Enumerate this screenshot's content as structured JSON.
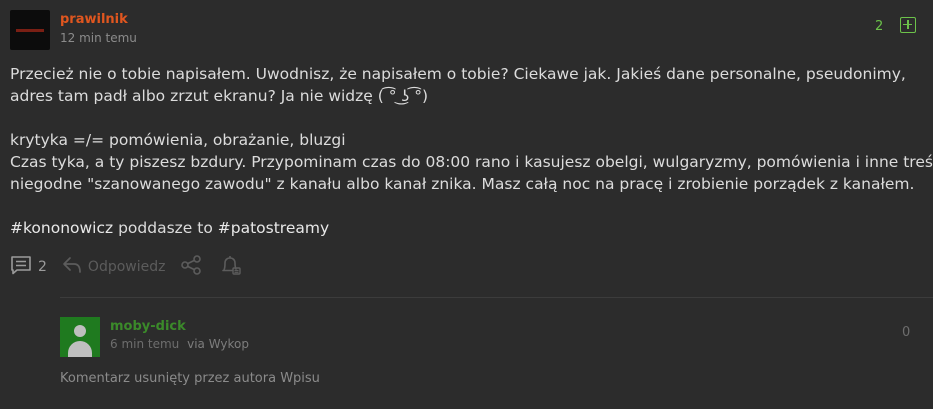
{
  "entry": {
    "author": "prawilnik",
    "time": "12 min temu",
    "votes": "2",
    "body": {
      "line1": "Przecież nie o tobie napisałem. Uwodnisz, że napisałem o tobie? Ciekawe jak. Jakieś dane personalne, pseudonimy,",
      "line2": "adres tam padł albo zrzut ekranu? Ja nie widzę ( ͡° ͜ʖ ͡°)",
      "line3": "krytyka =/= pomówienia, obrażanie, bluzgi",
      "line4": "Czas tyka, a ty piszesz bzdury. Przypominam czas do 08:00 rano i kasujesz obelgi, wulgaryzmy, pomówienia i inne treści",
      "line5": "niegodne \"szanowanego zawodu\" z kanału albo kanał znika. Masz całą noc na pracę i zrobienie porządek z kanałem.",
      "tag1": "#kononowicz",
      "middle": " poddasze to ",
      "tag2": "#patostreamy"
    },
    "actions": {
      "comments": "2",
      "reply": "Odpowiedz"
    }
  },
  "comment": {
    "author": "moby-dick",
    "time": "6 min temu",
    "via": "via Wykop",
    "votes": "0",
    "text": "Komentarz usunięty przez autora Wpisu"
  },
  "colors": {
    "background": "#2c2c2c",
    "author": "#e0561f",
    "vote_green": "#6cc24a",
    "sub_author": "#3b8a2a"
  }
}
